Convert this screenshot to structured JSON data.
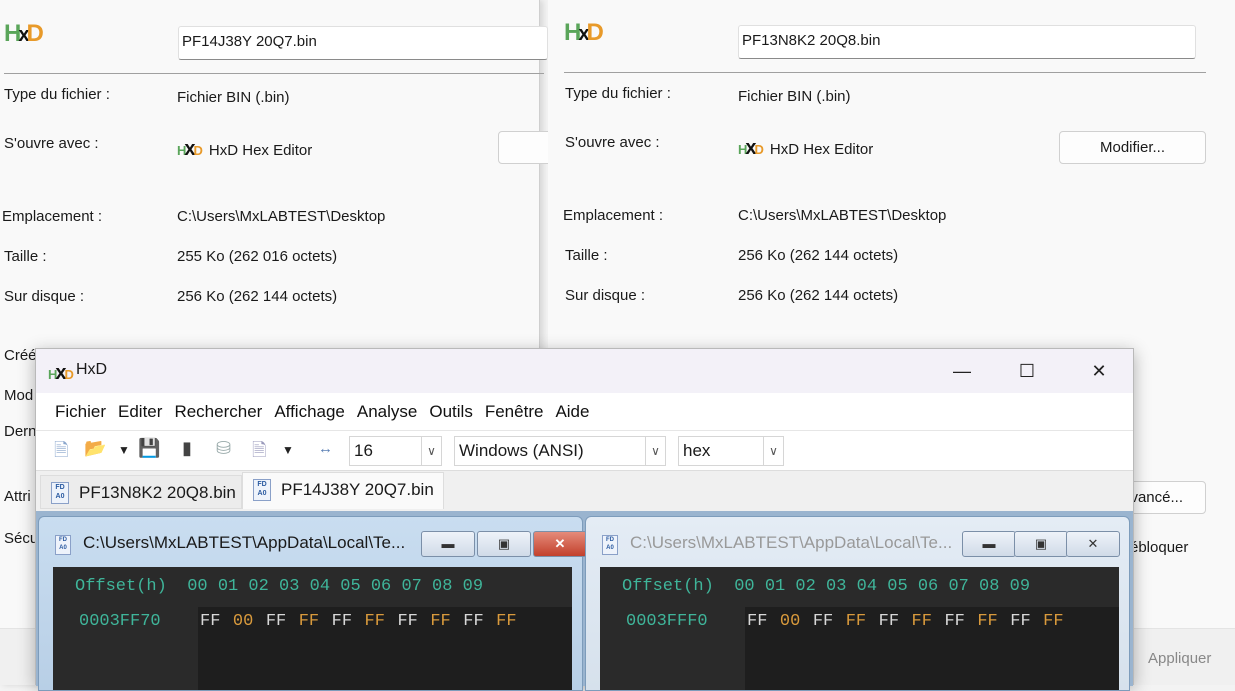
{
  "left_dialog": {
    "filename": "PF14J38Y 20Q7.bin",
    "rows": [
      {
        "label": "Type du fichier :",
        "value": "Fichier BIN (.bin)"
      },
      {
        "label": "S'ouvre avec :",
        "value": "HxD Hex Editor"
      },
      {
        "label": "Emplacement :",
        "value": "C:\\Users\\MxLABTEST\\Desktop"
      },
      {
        "label": "Taille :",
        "value": "255 Ko (262 016 octets)"
      },
      {
        "label": "Sur disque :",
        "value": "256 Ko (262 144 octets)"
      }
    ],
    "truncated_labels": [
      "Créé",
      "Mod",
      "Dern",
      "Attri",
      "Sécu"
    ]
  },
  "right_dialog": {
    "filename": "PF13N8K2 20Q8.bin",
    "rows": [
      {
        "label": "Type du fichier :",
        "value": "Fichier BIN (.bin)"
      },
      {
        "label": "S'ouvre avec :",
        "value": "HxD Hex Editor"
      },
      {
        "label": "Emplacement :",
        "value": "C:\\Users\\MxLABTEST\\Desktop"
      },
      {
        "label": "Taille :",
        "value": "256 Ko (262 144 octets)"
      },
      {
        "label": "Sur disque :",
        "value": "256 Ko (262 144 octets)"
      }
    ],
    "modify_button": "Modifier...",
    "advanced_button": "vancé...",
    "unblock_label": "ébloquer",
    "apply_button": "Appliquer"
  },
  "hxd": {
    "title": "HxD",
    "logo": "HxD",
    "menu": [
      "Fichier",
      "Editer",
      "Rechercher",
      "Affichage",
      "Analyse",
      "Outils",
      "Fenêtre",
      "Aide"
    ],
    "toolbar": {
      "bytes_per_row": "16",
      "charset": "Windows (ANSI)",
      "base": "hex"
    },
    "tabs": [
      "PF13N8K2 20Q8.bin",
      "PF14J38Y 20Q7.bin"
    ],
    "children": [
      {
        "title": "C:\\Users\\MxLABTEST\\AppData\\Local\\Te...",
        "header": "Offset(h)  00 01 02 03 04 05 06 07 08 09",
        "offset": "0003FF70",
        "bytes": [
          "FF",
          "00",
          "FF",
          "FF",
          "FF",
          "FF",
          "FF",
          "FF",
          "FF",
          "FF"
        ]
      },
      {
        "title": "C:\\Users\\MxLABTEST\\AppData\\Local\\Te...",
        "header": "Offset(h)  00 01 02 03 04 05 06 07 08 09",
        "offset": "0003FFF0",
        "bytes": [
          "FF",
          "00",
          "FF",
          "FF",
          "FF",
          "FF",
          "FF",
          "FF",
          "FF",
          "FF"
        ]
      }
    ]
  }
}
